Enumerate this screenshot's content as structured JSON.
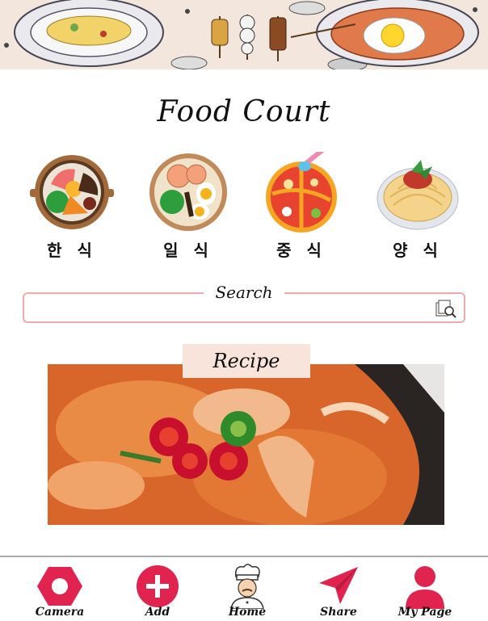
{
  "app": {
    "title": "Food Court"
  },
  "colors": {
    "accent": "#e0244f",
    "search_border": "#efaaae",
    "recipe_label_bg": "#f8e4da",
    "banner_bg": "#f3e6dc"
  },
  "categories": [
    {
      "label": "한 식",
      "icon": "bibimbap-icon"
    },
    {
      "label": "일 식",
      "icon": "ramen-icon"
    },
    {
      "label": "중 식",
      "icon": "hotpot-icon"
    },
    {
      "label": "양 식",
      "icon": "spaghetti-icon"
    }
  ],
  "search": {
    "label": "Search",
    "value": "",
    "placeholder": ""
  },
  "recipe": {
    "label": "Recipe"
  },
  "nav": [
    {
      "label": "Camera",
      "icon": "camera-icon"
    },
    {
      "label": "Add",
      "icon": "add-icon"
    },
    {
      "label": "Home",
      "icon": "chef-icon"
    },
    {
      "label": "Share",
      "icon": "share-icon"
    },
    {
      "label": "My Page",
      "icon": "user-icon"
    }
  ]
}
